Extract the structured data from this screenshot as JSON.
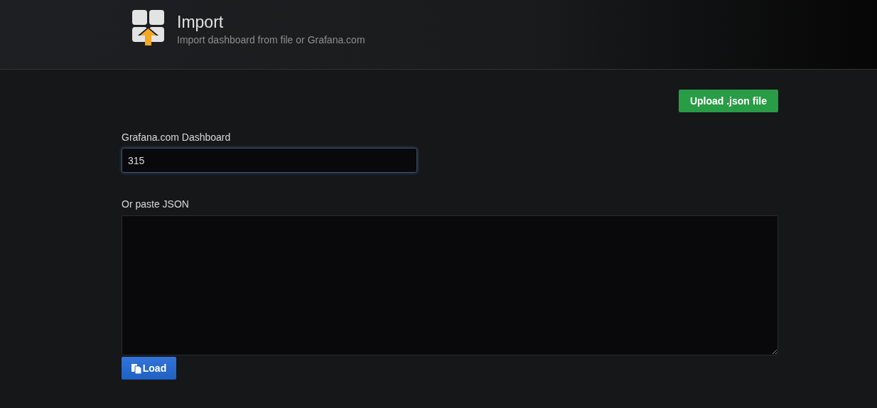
{
  "header": {
    "title": "Import",
    "subtitle": "Import dashboard from file or Grafana.com"
  },
  "upload_button": "Upload .json file",
  "dashboard_field": {
    "label": "Grafana.com Dashboard",
    "value": "315"
  },
  "json_field": {
    "label": "Or paste JSON"
  },
  "load_button": "Load"
}
